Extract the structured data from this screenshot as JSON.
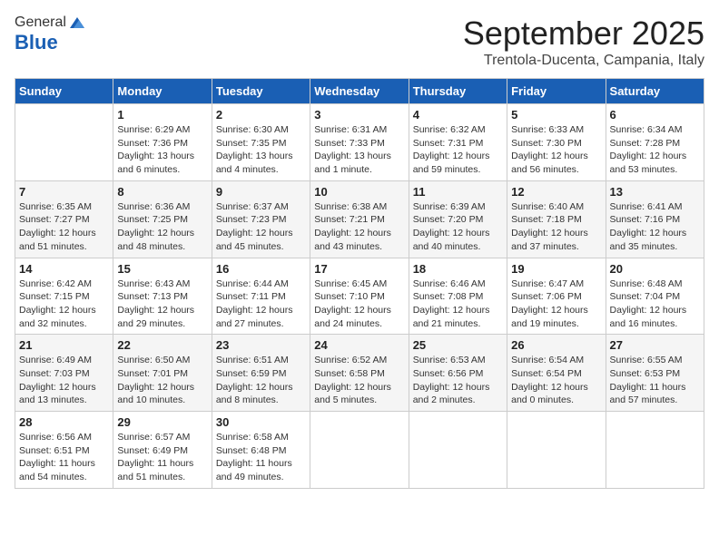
{
  "logo": {
    "general": "General",
    "blue": "Blue"
  },
  "header": {
    "month": "September 2025",
    "location": "Trentola-Ducenta, Campania, Italy"
  },
  "weekdays": [
    "Sunday",
    "Monday",
    "Tuesday",
    "Wednesday",
    "Thursday",
    "Friday",
    "Saturday"
  ],
  "weeks": [
    [
      {
        "day": "",
        "info": ""
      },
      {
        "day": "1",
        "info": "Sunrise: 6:29 AM\nSunset: 7:36 PM\nDaylight: 13 hours\nand 6 minutes."
      },
      {
        "day": "2",
        "info": "Sunrise: 6:30 AM\nSunset: 7:35 PM\nDaylight: 13 hours\nand 4 minutes."
      },
      {
        "day": "3",
        "info": "Sunrise: 6:31 AM\nSunset: 7:33 PM\nDaylight: 13 hours\nand 1 minute."
      },
      {
        "day": "4",
        "info": "Sunrise: 6:32 AM\nSunset: 7:31 PM\nDaylight: 12 hours\nand 59 minutes."
      },
      {
        "day": "5",
        "info": "Sunrise: 6:33 AM\nSunset: 7:30 PM\nDaylight: 12 hours\nand 56 minutes."
      },
      {
        "day": "6",
        "info": "Sunrise: 6:34 AM\nSunset: 7:28 PM\nDaylight: 12 hours\nand 53 minutes."
      }
    ],
    [
      {
        "day": "7",
        "info": "Sunrise: 6:35 AM\nSunset: 7:27 PM\nDaylight: 12 hours\nand 51 minutes."
      },
      {
        "day": "8",
        "info": "Sunrise: 6:36 AM\nSunset: 7:25 PM\nDaylight: 12 hours\nand 48 minutes."
      },
      {
        "day": "9",
        "info": "Sunrise: 6:37 AM\nSunset: 7:23 PM\nDaylight: 12 hours\nand 45 minutes."
      },
      {
        "day": "10",
        "info": "Sunrise: 6:38 AM\nSunset: 7:21 PM\nDaylight: 12 hours\nand 43 minutes."
      },
      {
        "day": "11",
        "info": "Sunrise: 6:39 AM\nSunset: 7:20 PM\nDaylight: 12 hours\nand 40 minutes."
      },
      {
        "day": "12",
        "info": "Sunrise: 6:40 AM\nSunset: 7:18 PM\nDaylight: 12 hours\nand 37 minutes."
      },
      {
        "day": "13",
        "info": "Sunrise: 6:41 AM\nSunset: 7:16 PM\nDaylight: 12 hours\nand 35 minutes."
      }
    ],
    [
      {
        "day": "14",
        "info": "Sunrise: 6:42 AM\nSunset: 7:15 PM\nDaylight: 12 hours\nand 32 minutes."
      },
      {
        "day": "15",
        "info": "Sunrise: 6:43 AM\nSunset: 7:13 PM\nDaylight: 12 hours\nand 29 minutes."
      },
      {
        "day": "16",
        "info": "Sunrise: 6:44 AM\nSunset: 7:11 PM\nDaylight: 12 hours\nand 27 minutes."
      },
      {
        "day": "17",
        "info": "Sunrise: 6:45 AM\nSunset: 7:10 PM\nDaylight: 12 hours\nand 24 minutes."
      },
      {
        "day": "18",
        "info": "Sunrise: 6:46 AM\nSunset: 7:08 PM\nDaylight: 12 hours\nand 21 minutes."
      },
      {
        "day": "19",
        "info": "Sunrise: 6:47 AM\nSunset: 7:06 PM\nDaylight: 12 hours\nand 19 minutes."
      },
      {
        "day": "20",
        "info": "Sunrise: 6:48 AM\nSunset: 7:04 PM\nDaylight: 12 hours\nand 16 minutes."
      }
    ],
    [
      {
        "day": "21",
        "info": "Sunrise: 6:49 AM\nSunset: 7:03 PM\nDaylight: 12 hours\nand 13 minutes."
      },
      {
        "day": "22",
        "info": "Sunrise: 6:50 AM\nSunset: 7:01 PM\nDaylight: 12 hours\nand 10 minutes."
      },
      {
        "day": "23",
        "info": "Sunrise: 6:51 AM\nSunset: 6:59 PM\nDaylight: 12 hours\nand 8 minutes."
      },
      {
        "day": "24",
        "info": "Sunrise: 6:52 AM\nSunset: 6:58 PM\nDaylight: 12 hours\nand 5 minutes."
      },
      {
        "day": "25",
        "info": "Sunrise: 6:53 AM\nSunset: 6:56 PM\nDaylight: 12 hours\nand 2 minutes."
      },
      {
        "day": "26",
        "info": "Sunrise: 6:54 AM\nSunset: 6:54 PM\nDaylight: 12 hours\nand 0 minutes."
      },
      {
        "day": "27",
        "info": "Sunrise: 6:55 AM\nSunset: 6:53 PM\nDaylight: 11 hours\nand 57 minutes."
      }
    ],
    [
      {
        "day": "28",
        "info": "Sunrise: 6:56 AM\nSunset: 6:51 PM\nDaylight: 11 hours\nand 54 minutes."
      },
      {
        "day": "29",
        "info": "Sunrise: 6:57 AM\nSunset: 6:49 PM\nDaylight: 11 hours\nand 51 minutes."
      },
      {
        "day": "30",
        "info": "Sunrise: 6:58 AM\nSunset: 6:48 PM\nDaylight: 11 hours\nand 49 minutes."
      },
      {
        "day": "",
        "info": ""
      },
      {
        "day": "",
        "info": ""
      },
      {
        "day": "",
        "info": ""
      },
      {
        "day": "",
        "info": ""
      }
    ]
  ]
}
